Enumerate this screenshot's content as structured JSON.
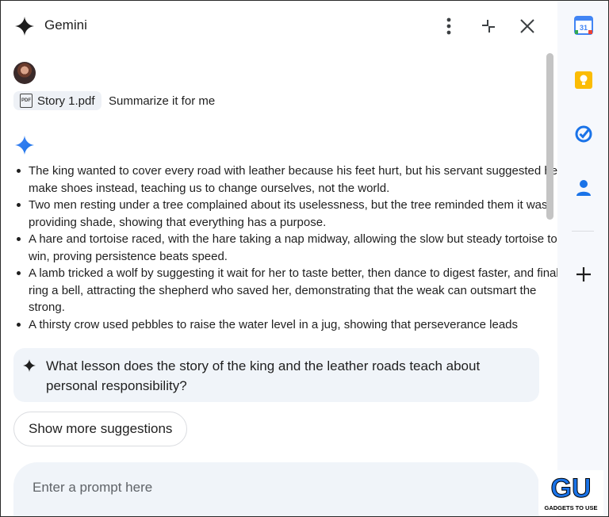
{
  "header": {
    "title": "Gemini",
    "icons": {
      "logo": "gemini-spark-icon",
      "menu": "more-vert-icon",
      "collapse": "collapse-icon",
      "close": "close-icon"
    }
  },
  "conversation": {
    "user_prompt": {
      "attachment_name": "Story 1.pdf",
      "attachment_icon_label": "PDF",
      "text": "Summarize it for me"
    },
    "response_bullets": [
      "The king wanted to cover every road with leather because his feet hurt, but his servant suggested he make shoes instead, teaching us to change ourselves, not the world.",
      "Two men resting under a tree complained about its uselessness, but the tree reminded them it was providing shade, showing that everything has a purpose.",
      "A hare and tortoise raced, with the hare taking a nap midway, allowing the slow but steady tortoise to win, proving persistence beats speed.",
      "A lamb tricked a wolf by suggesting it wait for her to taste better, then dance to digest faster, and finally ring a bell, attracting the shepherd who saved her, demonstrating that the weak can outsmart the strong.",
      "A thirsty crow used pebbles to raise the water level in a jug, showing that perseverance leads"
    ]
  },
  "suggestion": {
    "text": "What lesson does the story of the king and the leather roads teach about personal responsibility?"
  },
  "more_suggestions_label": "Show more suggestions",
  "prompt_input": {
    "placeholder": "Enter a prompt here",
    "value": ""
  },
  "side_rail": {
    "calendar_day": "31",
    "icons": [
      "calendar-icon",
      "keep-icon",
      "tasks-icon",
      "contacts-icon",
      "add-icon"
    ]
  },
  "watermark": {
    "top": "GU",
    "bottom": "GADGETS TO USE"
  },
  "colors": {
    "accent_blue": "#1a73e8",
    "keep_yellow": "#fbbc04",
    "panel_bg": "#f0f4f9"
  }
}
